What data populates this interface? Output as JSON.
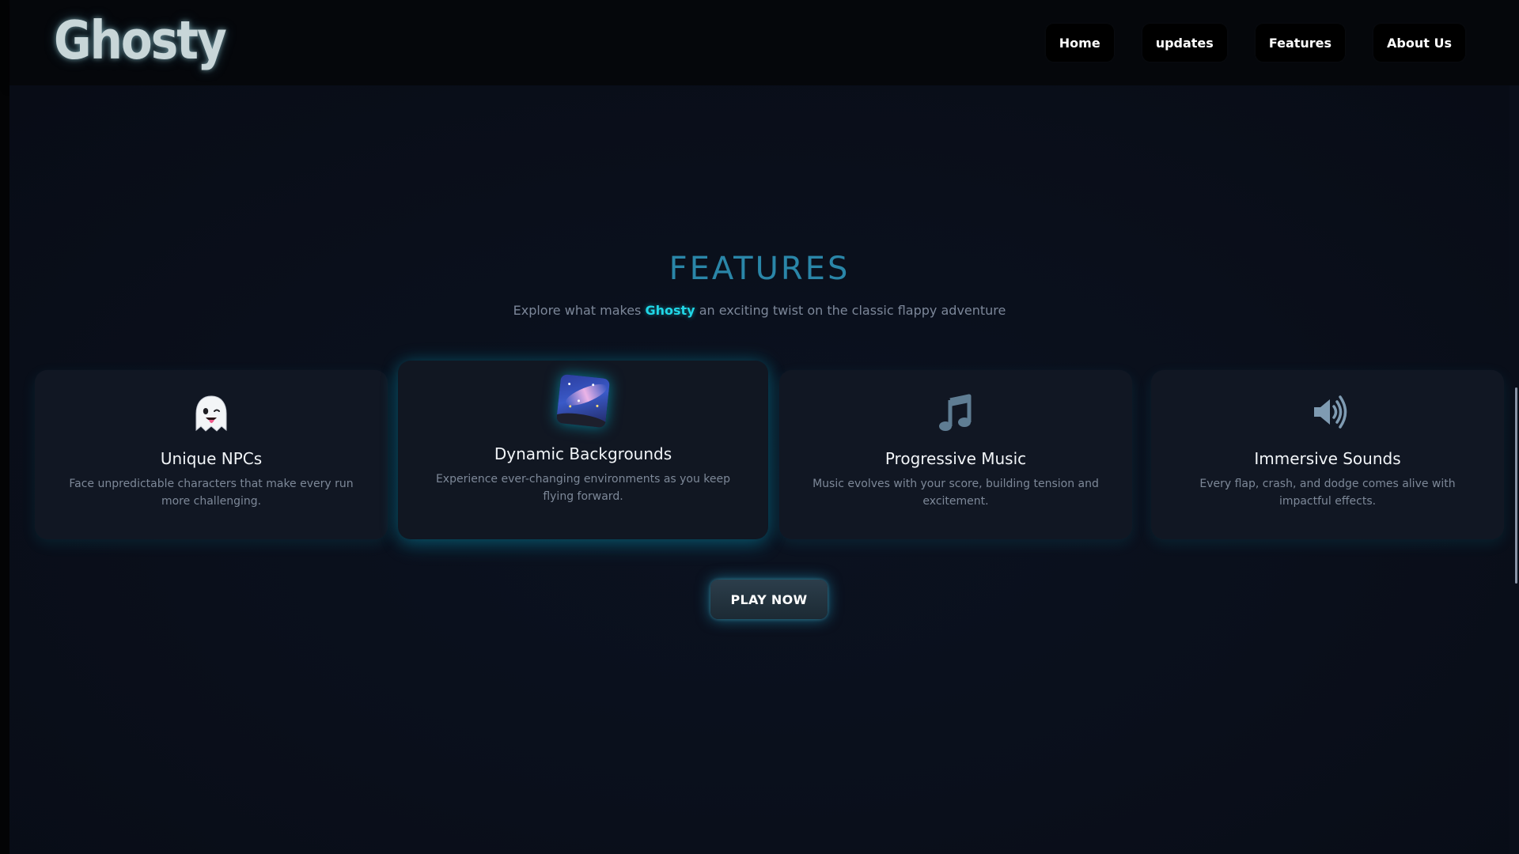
{
  "navbar": {
    "logo": "Ghosty",
    "links": [
      "Home",
      "updates",
      "Features",
      "About Us"
    ]
  },
  "features": {
    "title": "FEATURES",
    "subtitle_before": "Explore what makes ",
    "subtitle_brand": "Ghosty",
    "subtitle_after": " an exciting twist on the classic flappy adventure",
    "cards": [
      {
        "icon": "ghost-icon",
        "title": "Unique NPCs",
        "description": "Face unpredictable characters that make every run more challenging."
      },
      {
        "icon": "milky-way-icon",
        "title": "Dynamic Backgrounds",
        "description": "Experience ever-changing environments as you keep flying forward."
      },
      {
        "icon": "music-note-icon",
        "title": "Progressive Music",
        "description": "Music evolves with your score, building tension and excitement."
      },
      {
        "icon": "speaker-icon",
        "title": "Immersive Sounds",
        "description": "Every flap, crash, and dodge comes alive with impactful effects."
      }
    ]
  },
  "cta": {
    "play_label": "PLAY NOW"
  },
  "colors": {
    "accent": "#2a86a8",
    "brand_highlight": "#20d6e6",
    "background": "#0a0f1b",
    "card": "#111723"
  }
}
